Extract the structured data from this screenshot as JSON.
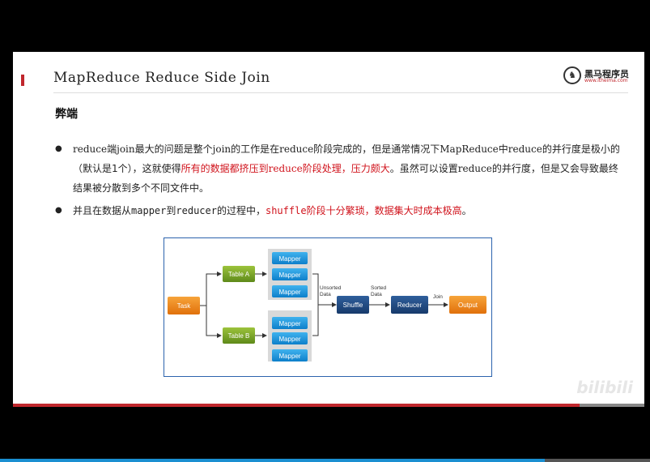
{
  "slide": {
    "title": "MapReduce Reduce Side Join",
    "logo": {
      "name": "黑马程序员",
      "url": "www.itheima.com"
    },
    "heading": "弊端",
    "bullet1": {
      "p1": "reduce",
      "p2": "端",
      "p3": "join",
      "p4": "最大的问题是整个",
      "p5": "join",
      "p6": "的工作是在",
      "p7": "reduce",
      "p8": "阶段完成的，但是通常情况下",
      "p9": "MapReduce",
      "p10": "中",
      "p11": "reduce",
      "p12": "的并行度是极小的（默认是1个），这就使得",
      "p13": "所有的数据都挤压到",
      "p14": "reduce",
      "p15": "阶段处理，压力颇大",
      "p16": "。虽然可以设置",
      "p17": "reduce",
      "p18": "的并行度，但是又会导致最终结果被分散到多个不同文件中。"
    },
    "bullet2": {
      "p1": "并且在数据从",
      "p2": "mapper",
      "p3": "到",
      "p4": "reducer",
      "p5": "的过程中，",
      "p6": "shuffle",
      "p7": "阶段十分繁琐，数据集大时成本极高",
      "p8": "。"
    },
    "watermark": "bilibili"
  },
  "diagram": {
    "task": "Task",
    "table_a": "Table A",
    "table_b": "Table B",
    "mapper": "Mapper",
    "unsorted_1": "Unsorted",
    "unsorted_2": "Data",
    "sorted_1": "Sorted",
    "sorted_2": "Data",
    "shuffle": "Shuffle",
    "reducer": "Reducer",
    "join": "Join",
    "output": "Output"
  }
}
